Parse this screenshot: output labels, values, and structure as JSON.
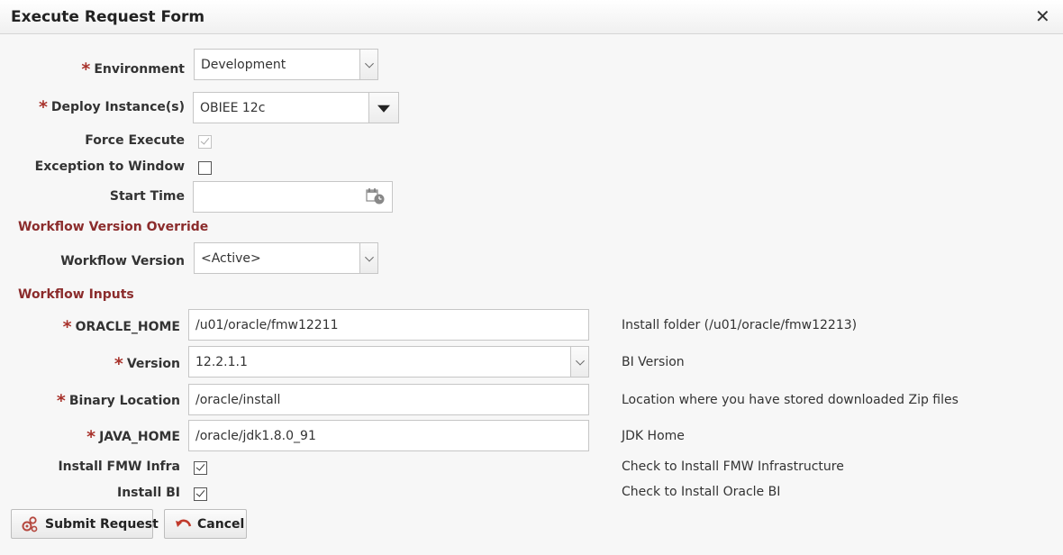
{
  "dialog": {
    "title": "Execute Request Form",
    "close_glyph": "✕"
  },
  "form": {
    "environment": {
      "label": "Environment",
      "value": "Development",
      "required": true
    },
    "deploy_instances": {
      "label": "Deploy Instance(s)",
      "value": "OBIEE 12c",
      "required": true
    },
    "force_execute": {
      "label": "Force Execute",
      "checked": true,
      "disabled": true
    },
    "exception_to_window": {
      "label": "Exception to Window",
      "checked": false
    },
    "start_time": {
      "label": "Start Time",
      "value": ""
    },
    "workflow_version_override": {
      "heading": "Workflow Version Override"
    },
    "workflow_version": {
      "label": "Workflow Version",
      "value": "<Active>"
    },
    "workflow_inputs": {
      "heading": "Workflow Inputs"
    },
    "oracle_home": {
      "label": "ORACLE_HOME",
      "value": "/u01/oracle/fmw12211",
      "help": "Install folder (/u01/oracle/fmw12213)",
      "required": true
    },
    "version": {
      "label": "Version",
      "value": "12.2.1.1",
      "help": "BI Version",
      "required": true
    },
    "binary_location": {
      "label": "Binary Location",
      "value": "/oracle/install",
      "help": "Location where you have stored downloaded Zip files",
      "required": true
    },
    "java_home": {
      "label": "JAVA_HOME",
      "value": "/oracle/jdk1.8.0_91",
      "help": "JDK Home",
      "required": true
    },
    "install_fmw_infra": {
      "label": "Install FMW Infra",
      "checked": true,
      "help": "Check to Install FMW Infrastructure"
    },
    "install_bi": {
      "label": "Install BI",
      "checked": true,
      "help": "Check to Install Oracle BI"
    }
  },
  "buttons": {
    "submit": "Submit Request",
    "cancel": "Cancel"
  },
  "colors": {
    "required_star": "#a8322b",
    "section_heading": "#8b2c2c",
    "submit_icon": "#b5483f",
    "cancel_icon": "#c0392b"
  },
  "icons": {
    "close": "close-icon",
    "calendar": "calendar-clock-icon",
    "submit": "gears-icon",
    "cancel": "undo-arrow-icon"
  }
}
